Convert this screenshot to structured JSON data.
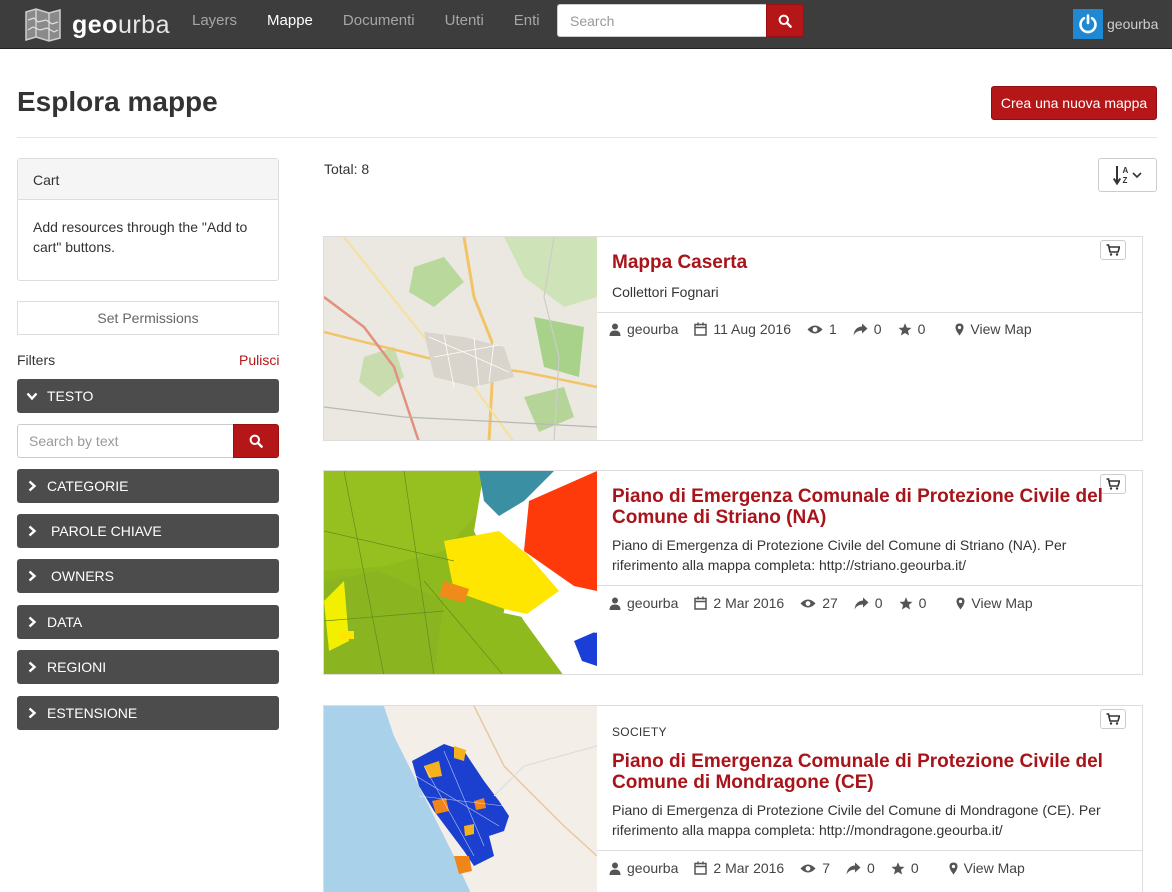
{
  "navbar": {
    "brand_bold": "geo",
    "brand_light": "urba",
    "links": [
      {
        "label": "Layers",
        "active": false
      },
      {
        "label": "Mappe",
        "active": true
      },
      {
        "label": "Documenti",
        "active": false
      },
      {
        "label": "Utenti",
        "active": false
      },
      {
        "label": "Enti",
        "active": false
      }
    ],
    "search_placeholder": "Search",
    "username": "geourba"
  },
  "header": {
    "title": "Esplora mappe",
    "new_map_label": "Crea una nuova mappa"
  },
  "sidebar": {
    "cart_title": "Cart",
    "cart_body": "Add resources through the \"Add to cart\" buttons.",
    "permissions_label": "Set Permissions",
    "filters_label": "Filters",
    "filters_clear": "Pulisci",
    "text_search_placeholder": "Search by text",
    "facets": [
      {
        "label": "TESTO",
        "expanded": true
      },
      {
        "label": "CATEGORIE",
        "expanded": false
      },
      {
        "label": "PAROLE CHIAVE",
        "expanded": false
      },
      {
        "label": "OWNERS",
        "expanded": false
      },
      {
        "label": "DATA",
        "expanded": false
      },
      {
        "label": "REGIONI",
        "expanded": false
      },
      {
        "label": "ESTENSIONE",
        "expanded": false
      }
    ]
  },
  "results": {
    "total": "Total: 8",
    "items": [
      {
        "category": "",
        "title": "Mappa Caserta",
        "abstract": "Collettori Fognari",
        "owner": "geourba",
        "date": "11 Aug 2016",
        "views": "1",
        "shares": "0",
        "rating": "0",
        "view_label": "View Map"
      },
      {
        "category": "",
        "title": "Piano di Emergenza Comunale di Protezione Civile del Comune di Striano (NA)",
        "abstract": "Piano di Emergenza di Protezione Civile del Comune di Striano (NA). Per riferimento alla mappa completa: http://striano.geourba.it/",
        "owner": "geourba",
        "date": "2 Mar 2016",
        "views": "27",
        "shares": "0",
        "rating": "0",
        "view_label": "View Map"
      },
      {
        "category": "SOCIETY",
        "title": "Piano di Emergenza Comunale di Protezione Civile del Comune di Mondragone (CE)",
        "abstract": "Piano di Emergenza di Protezione Civile del Comune di Mondragone (CE). Per riferimento alla mappa completa: http://mondragone.geourba.it/",
        "owner": "geourba",
        "date": "2 Mar 2016",
        "views": "7",
        "shares": "0",
        "rating": "0",
        "view_label": "View Map"
      }
    ]
  },
  "colors": {
    "navbar_bg": "#3d3d3d",
    "accent_red": "#b51618",
    "title_red": "#a8141a",
    "facet_bg": "#4c4c4c"
  }
}
